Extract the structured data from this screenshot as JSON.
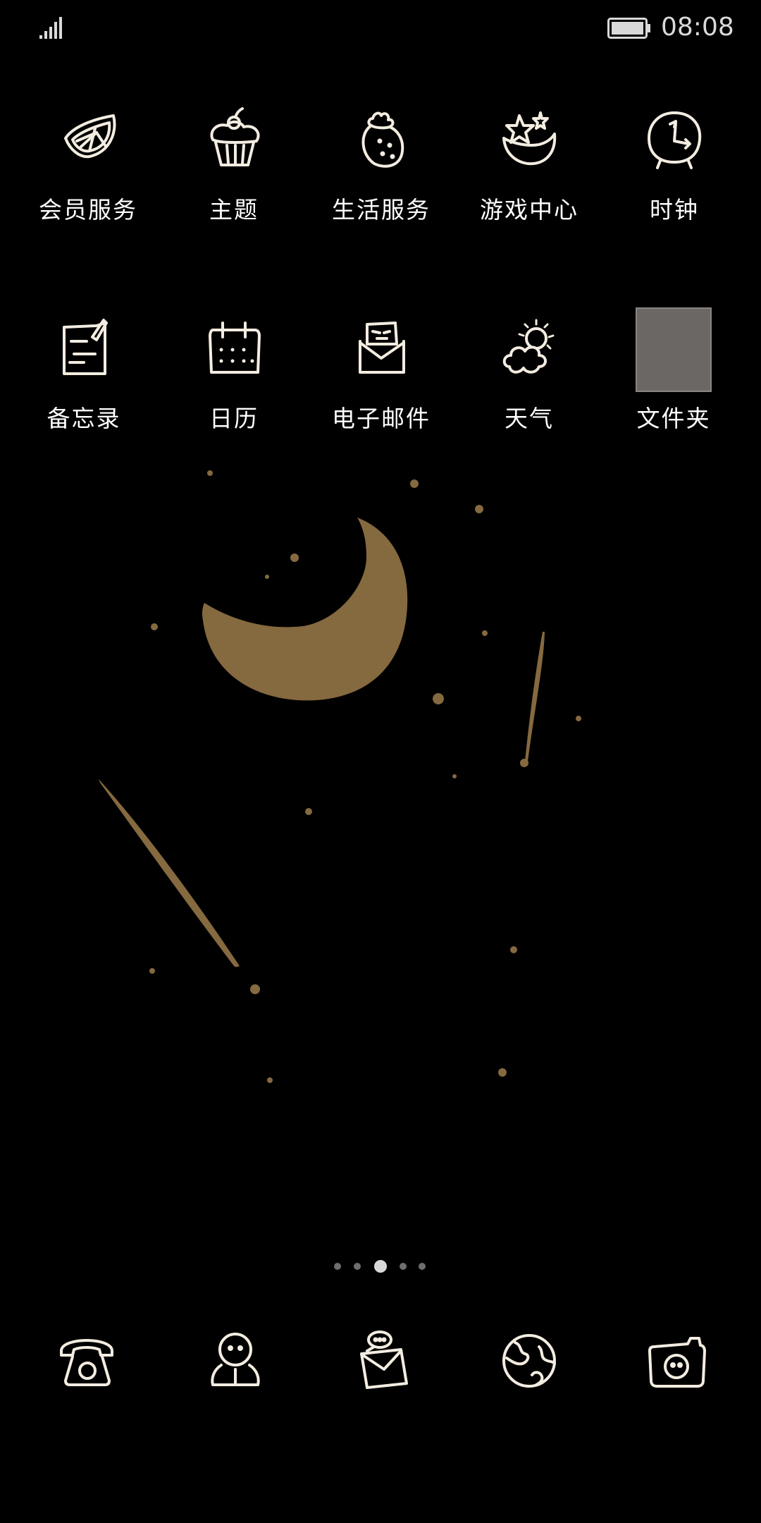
{
  "status_bar": {
    "time": "08:08",
    "icons": [
      "signal-icon",
      "battery-icon"
    ]
  },
  "apps_row1": [
    {
      "label": "会员服务",
      "icon": "citrus-slice-icon"
    },
    {
      "label": "主题",
      "icon": "cupcake-icon"
    },
    {
      "label": "生活服务",
      "icon": "strawberry-icon"
    },
    {
      "label": "游戏中心",
      "icon": "star-bowl-icon"
    },
    {
      "label": "时钟",
      "icon": "clock-icon"
    }
  ],
  "apps_row2": [
    {
      "label": "备忘录",
      "icon": "memo-icon"
    },
    {
      "label": "日历",
      "icon": "calendar-icon"
    },
    {
      "label": "电子邮件",
      "icon": "email-icon"
    },
    {
      "label": "天气",
      "icon": "weather-icon"
    },
    {
      "label": "文件夹",
      "icon": "folder-icon"
    }
  ],
  "page_indicator": {
    "count": 5,
    "active_index": 2
  },
  "dock": [
    {
      "icon": "phone-icon"
    },
    {
      "icon": "contacts-icon"
    },
    {
      "icon": "messages-icon"
    },
    {
      "icon": "browser-icon"
    },
    {
      "icon": "camera-icon"
    }
  ],
  "colors": {
    "background": "#000000",
    "wallpaper_gold": "#8b6f45",
    "icon_stroke": "#f3ece0",
    "folder_fill": "#6b6764"
  }
}
